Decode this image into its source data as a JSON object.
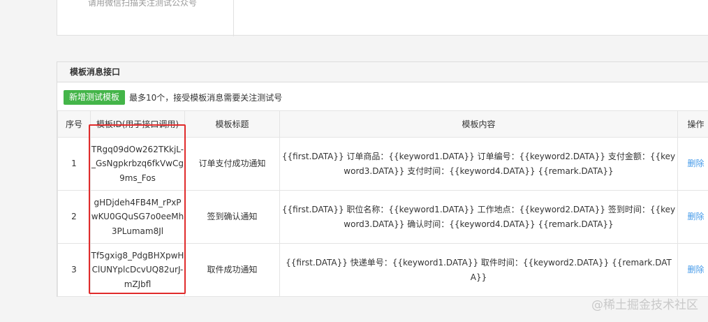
{
  "top_panel": {
    "hint": "请用微信扫描关注测试公众号"
  },
  "template_panel": {
    "title": "模板消息接口",
    "add_button": "新增测试模板",
    "note": "最多10个，接受模板消息需要关注测试号",
    "columns": [
      "序号",
      "模板ID(用于接口调用)",
      "模板标题",
      "模板内容",
      "操作"
    ],
    "rows": [
      {
        "index": "1",
        "template_id": "TRgq09dOw262TKkjL-_GsNgpkrbzq6fkVwCg9ms_Fos",
        "title": "订单支付成功通知",
        "content": "{{first.DATA}} 订单商品：{{keyword1.DATA}} 订单编号：{{keyword2.DATA}} 支付金额：{{keyword3.DATA}} 支付时间：{{keyword4.DATA}} {{remark.DATA}}",
        "action": "删除"
      },
      {
        "index": "2",
        "template_id": "gHDjdeh4FB4M_rPxPwKU0GQuSG7o0eeMh3PLumam8Jl",
        "title": "签到确认通知",
        "content": "{{first.DATA}} 职位名称：{{keyword1.DATA}} 工作地点：{{keyword2.DATA}} 签到时间：{{keyword3.DATA}} 确认时间：{{keyword4.DATA}} {{remark.DATA}}",
        "action": "删除"
      },
      {
        "index": "3",
        "template_id": "Tf5gxig8_PdgBHXpwHClUNYplcDcvUQ82urJ-mZJbfl",
        "title": "取件成功通知",
        "content": "{{first.DATA}} 快递单号：{{keyword1.DATA}} 取件时间：{{keyword2.DATA}} {{remark.DATA}}",
        "action": "删除"
      }
    ]
  },
  "annotation": {
    "color": "#e02b2b"
  },
  "watermark": "@稀土掘金技术社区"
}
